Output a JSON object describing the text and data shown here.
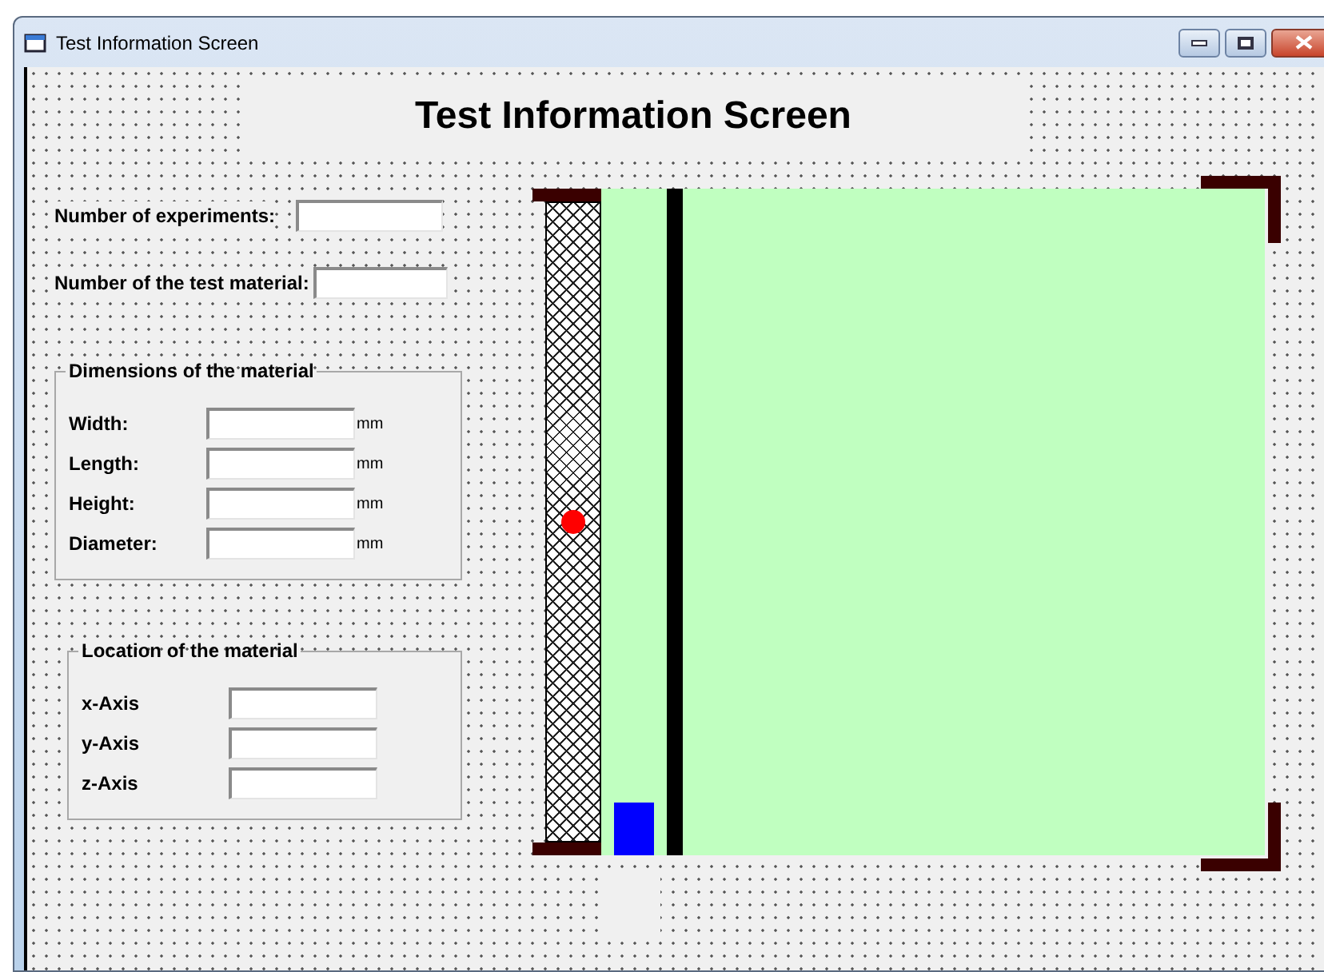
{
  "window": {
    "title": "Test Information Screen"
  },
  "heading": "Test Information Screen",
  "fields": [
    {
      "label": "Number of experiments:"
    },
    {
      "label": "Number of the test material:"
    }
  ],
  "groups": [
    {
      "title": "Dimensions of the material",
      "rows": [
        {
          "label": "Width:",
          "unit": "mm"
        },
        {
          "label": "Length:",
          "unit": "mm"
        },
        {
          "label": "Height:",
          "unit": "mm"
        },
        {
          "label": "Diameter:",
          "unit": "mm"
        }
      ]
    },
    {
      "title": "Location of the material",
      "rows": [
        {
          "label": "x-Axis"
        },
        {
          "label": "y-Axis"
        },
        {
          "label": "z-Axis"
        }
      ]
    }
  ]
}
